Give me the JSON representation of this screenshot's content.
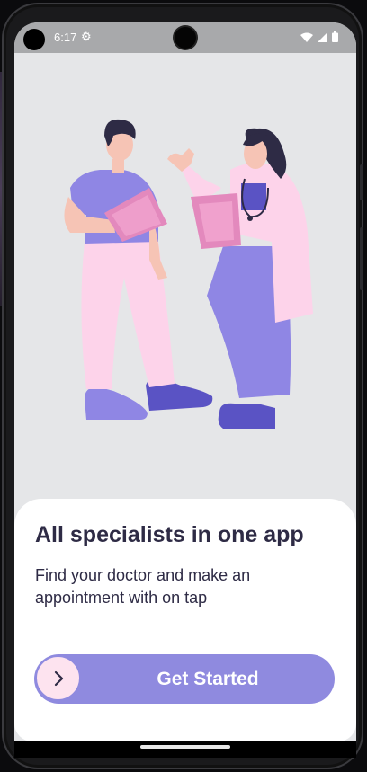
{
  "status_bar": {
    "time": "6:17",
    "icons": [
      "settings-gear-icon",
      "wifi-icon",
      "signal-icon",
      "battery-icon"
    ]
  },
  "illustration": {
    "subject": "doctors-illustration",
    "colors": {
      "pink": "#fdd3ea",
      "purple": "#8f86e4",
      "dark_purple": "#5a53c4",
      "skin": "#f6c4b5",
      "clipboard": "#e389bd"
    }
  },
  "onboarding": {
    "title": "All specialists in one app",
    "subtitle": "Find your doctor and make an\n appointment with on tap"
  },
  "cta": {
    "label": "Get Started",
    "icon": "chevron-right-icon",
    "color": "#8f8adf",
    "knob_color": "#fde3ef"
  }
}
